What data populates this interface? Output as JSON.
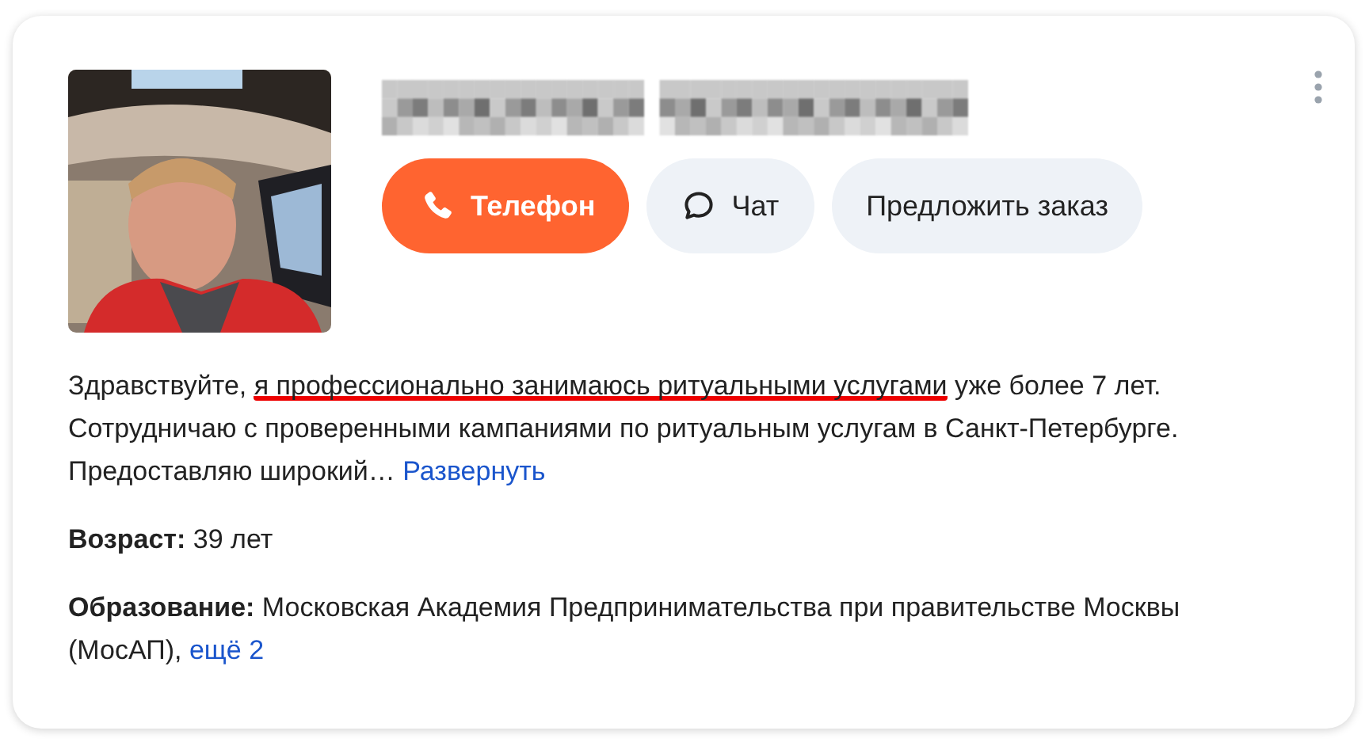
{
  "buttons": [
    {
      "kind": "phone",
      "label": "Телефон"
    },
    {
      "kind": "chat",
      "label": "Чат"
    },
    {
      "kind": "plain",
      "label": "Предложить заказ"
    }
  ],
  "about": {
    "segments": [
      {
        "text": "Здравствуйте, ",
        "underlined": false
      },
      {
        "text": "я профессионально занимаюсь ритуальными услугами",
        "underlined": true
      },
      {
        "text": " уже более 7 лет. Сотрудничаю с проверенными кампаниями по ритуальным услугам в Санкт-Петербурге. Предоставляю широкий… ",
        "underlined": false
      }
    ],
    "link": "Развернуть"
  },
  "facts": [
    {
      "label": "Возраст:",
      "value": " 39 лет"
    },
    {
      "label": "Образование:",
      "value": " Московская Академия Предпринимательства при правительстве Москвы (МосАП), ",
      "link": "ещё 2"
    }
  ]
}
